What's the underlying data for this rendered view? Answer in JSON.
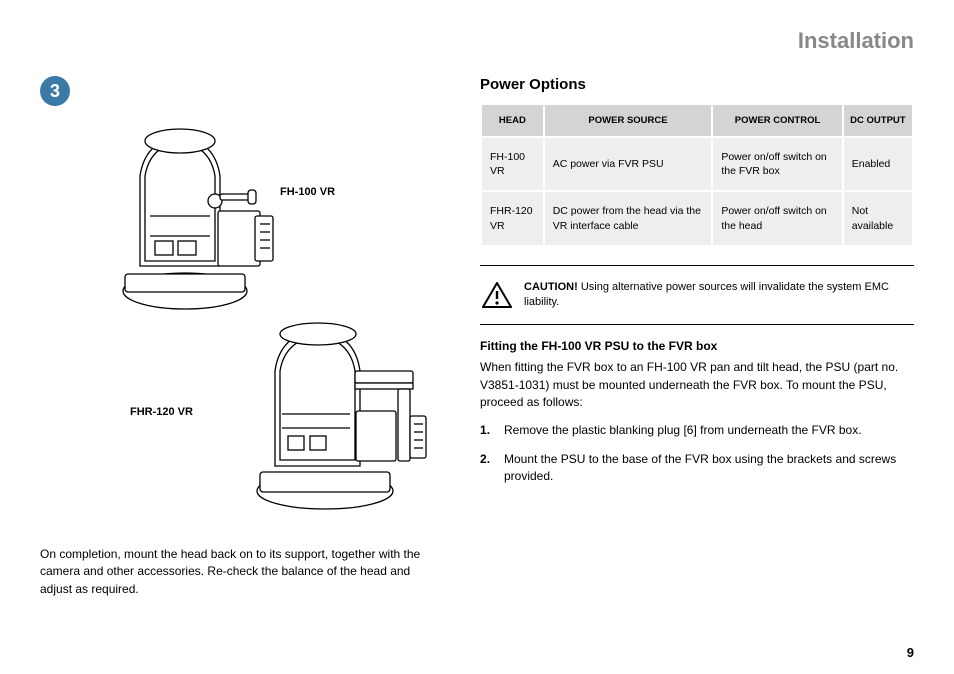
{
  "page_title": "Installation",
  "step_number": "3",
  "diagram": {
    "label_a": "FH-100 VR",
    "label_b": "FHR-120 VR"
  },
  "left_note": "On completion, mount the head back on to its support, together with the camera and other accessories. Re-check the balance of the head and adjust as required.",
  "right": {
    "section_heading": "Power Options",
    "table": {
      "headers": [
        "HEAD",
        "POWER SOURCE",
        "POWER CONTROL",
        "DC OUTPUT"
      ],
      "rows": [
        [
          "FH-100 VR",
          "AC power via FVR PSU",
          "Power on/off switch on the FVR box",
          "Enabled"
        ],
        [
          "FHR-120 VR",
          "DC power from the head via the VR interface cable",
          "Power on/off switch on the head",
          "Not available"
        ]
      ]
    },
    "caution_strong": "CAUTION!",
    "caution_text": " Using alternative power sources will invalidate the system EMC liability.",
    "sub_heading": "Fitting the FH-100 VR PSU to the FVR box",
    "body_text": "When fitting the FVR box to an FH-100 VR pan and tilt head, the PSU (part no. V3851-1031) must be mounted underneath the FVR box. To mount the PSU, proceed as follows:",
    "steps": [
      "Remove the plastic blanking plug [6] from underneath the FVR box.",
      "Mount the PSU to the base of the FVR box using the brackets and screws provided."
    ]
  },
  "page_number": "9"
}
